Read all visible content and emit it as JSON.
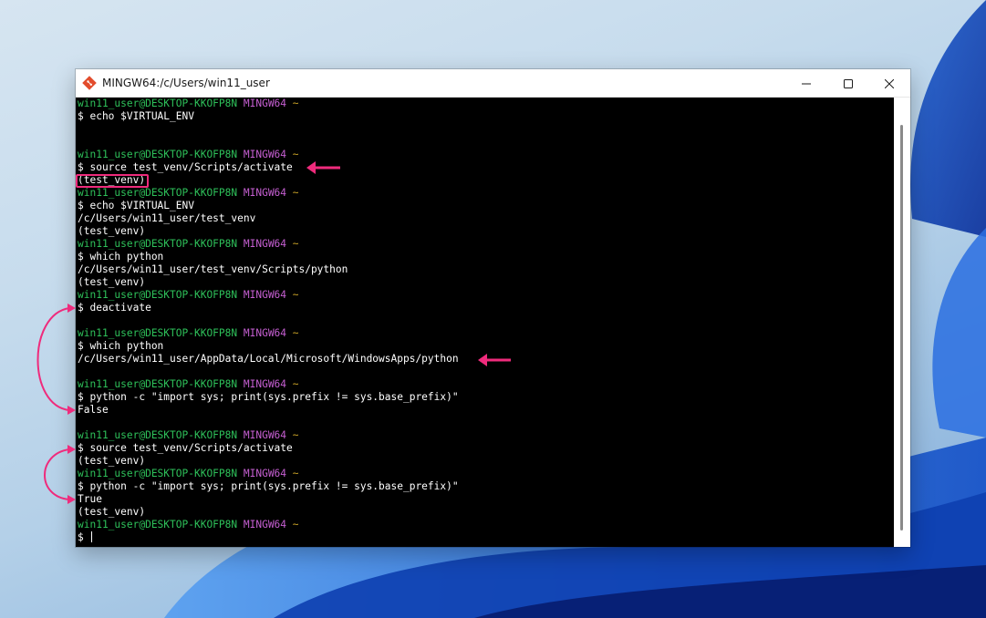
{
  "window": {
    "title": "MINGW64:/c/Users/win11_user"
  },
  "colors": {
    "user_host": "#2ec15a",
    "shell_name": "#c55fd1",
    "tilde": "#c9a227",
    "annotation": "#ef2b7c"
  },
  "terminal": {
    "lines": [
      {
        "kind": "prompt",
        "user": "win11_user@DESKTOP-KKOFP8N",
        "shell": "MINGW64",
        "dir": "~"
      },
      {
        "kind": "text",
        "text": "$ echo $VIRTUAL_ENV"
      },
      {
        "kind": "text",
        "text": ""
      },
      {
        "kind": "text",
        "text": ""
      },
      {
        "kind": "prompt",
        "user": "win11_user@DESKTOP-KKOFP8N",
        "shell": "MINGW64",
        "dir": "~"
      },
      {
        "kind": "text",
        "text": "$ source test_venv/Scripts/activate"
      },
      {
        "kind": "text",
        "text": "(test_venv)"
      },
      {
        "kind": "prompt",
        "user": "win11_user@DESKTOP-KKOFP8N",
        "shell": "MINGW64",
        "dir": "~"
      },
      {
        "kind": "text",
        "text": "$ echo $VIRTUAL_ENV"
      },
      {
        "kind": "text",
        "text": "/c/Users/win11_user/test_venv"
      },
      {
        "kind": "text",
        "text": "(test_venv)"
      },
      {
        "kind": "prompt",
        "user": "win11_user@DESKTOP-KKOFP8N",
        "shell": "MINGW64",
        "dir": "~"
      },
      {
        "kind": "text",
        "text": "$ which python"
      },
      {
        "kind": "text",
        "text": "/c/Users/win11_user/test_venv/Scripts/python"
      },
      {
        "kind": "text",
        "text": "(test_venv)"
      },
      {
        "kind": "prompt",
        "user": "win11_user@DESKTOP-KKOFP8N",
        "shell": "MINGW64",
        "dir": "~"
      },
      {
        "kind": "text",
        "text": "$ deactivate"
      },
      {
        "kind": "text",
        "text": ""
      },
      {
        "kind": "prompt",
        "user": "win11_user@DESKTOP-KKOFP8N",
        "shell": "MINGW64",
        "dir": "~"
      },
      {
        "kind": "text",
        "text": "$ which python"
      },
      {
        "kind": "text",
        "text": "/c/Users/win11_user/AppData/Local/Microsoft/WindowsApps/python"
      },
      {
        "kind": "text",
        "text": ""
      },
      {
        "kind": "prompt",
        "user": "win11_user@DESKTOP-KKOFP8N",
        "shell": "MINGW64",
        "dir": "~"
      },
      {
        "kind": "text",
        "text": "$ python -c \"import sys; print(sys.prefix != sys.base_prefix)\""
      },
      {
        "kind": "text",
        "text": "False"
      },
      {
        "kind": "text",
        "text": ""
      },
      {
        "kind": "prompt",
        "user": "win11_user@DESKTOP-KKOFP8N",
        "shell": "MINGW64",
        "dir": "~"
      },
      {
        "kind": "text",
        "text": "$ source test_venv/Scripts/activate"
      },
      {
        "kind": "text",
        "text": "(test_venv)"
      },
      {
        "kind": "prompt",
        "user": "win11_user@DESKTOP-KKOFP8N",
        "shell": "MINGW64",
        "dir": "~"
      },
      {
        "kind": "text",
        "text": "$ python -c \"import sys; print(sys.prefix != sys.base_prefix)\""
      },
      {
        "kind": "text",
        "text": "True"
      },
      {
        "kind": "text",
        "text": "(test_venv)"
      },
      {
        "kind": "prompt",
        "user": "win11_user@DESKTOP-KKOFP8N",
        "shell": "MINGW64",
        "dir": "~"
      },
      {
        "kind": "input",
        "text": "$ "
      }
    ]
  }
}
